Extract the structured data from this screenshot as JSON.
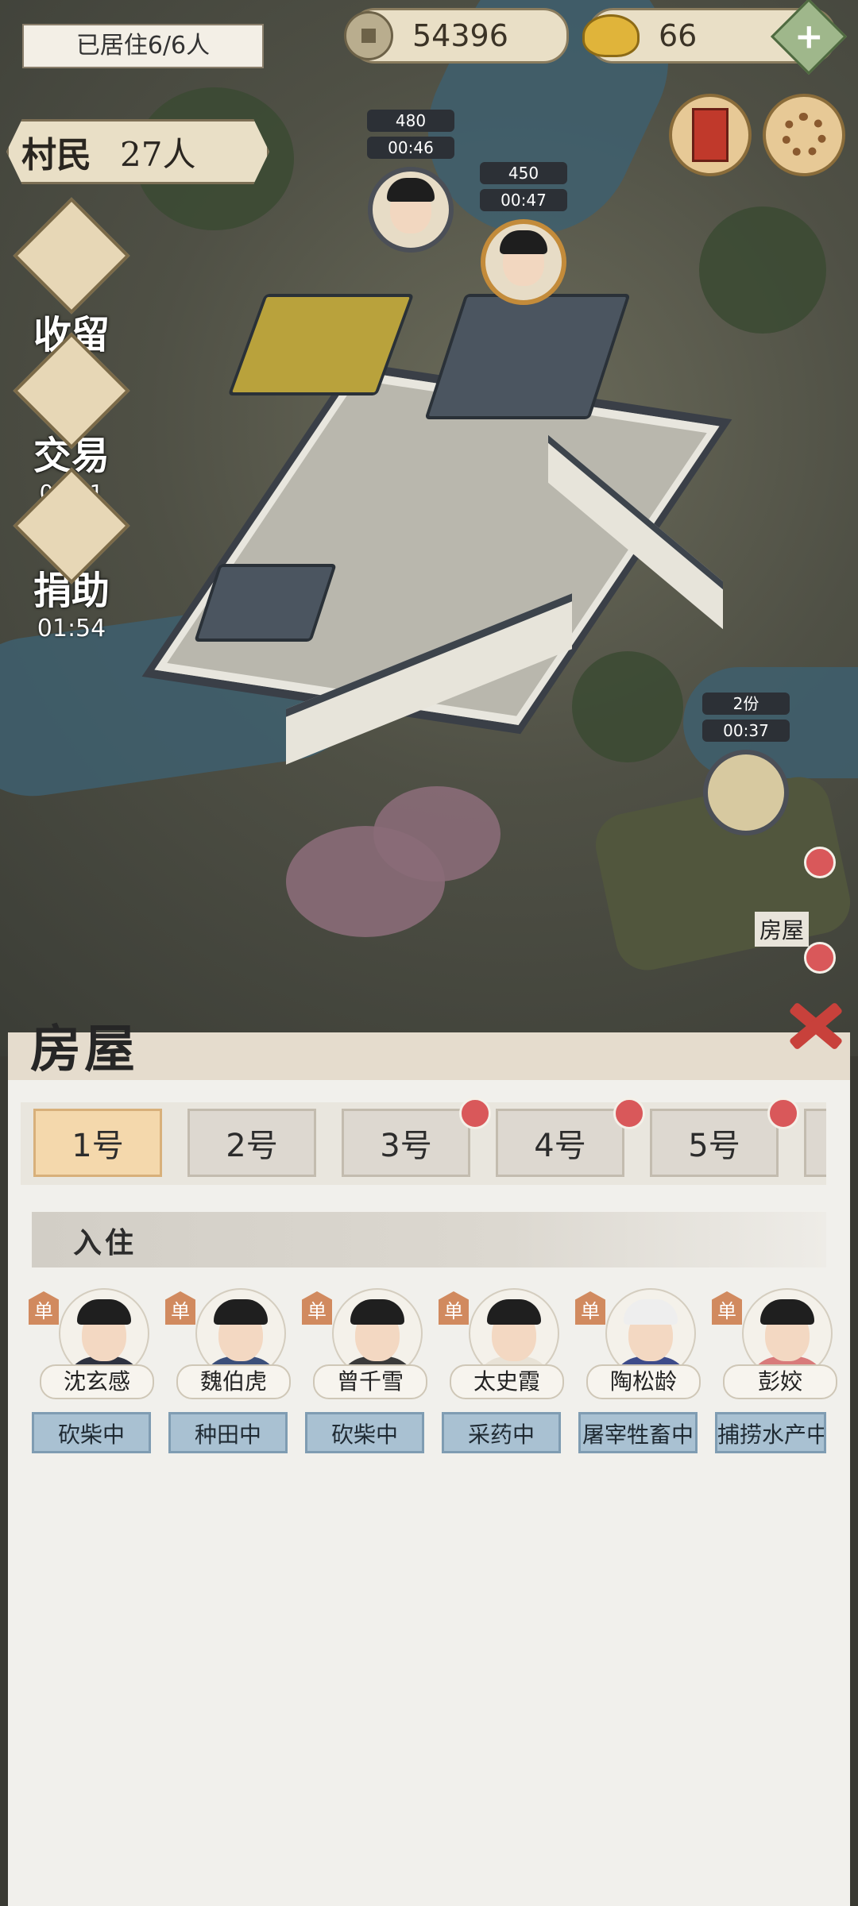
{
  "hud": {
    "occupancy_banner": "已居住6/6人",
    "coins": "54396",
    "ingots": "66",
    "plus_icon": "plus-icon",
    "villagers_label": "村民",
    "villagers_count": "27人"
  },
  "side_buttons": {
    "shelter": {
      "label": "收留"
    },
    "trade": {
      "label": "交易",
      "timer": "00:21"
    },
    "donate": {
      "label": "捐助",
      "timer": "01:54"
    }
  },
  "map_markers": {
    "m1": {
      "amount": "480",
      "timer": "00:46"
    },
    "m2": {
      "amount": "450",
      "timer": "00:47"
    },
    "m3": {
      "amount": "2份",
      "timer": "00:37"
    },
    "house_label": "房屋"
  },
  "panel": {
    "title": "房屋",
    "tabs": [
      {
        "label": "1号",
        "active": true,
        "red_dot": false
      },
      {
        "label": "2号",
        "active": false,
        "red_dot": false
      },
      {
        "label": "3号",
        "active": false,
        "red_dot": true
      },
      {
        "label": "4号",
        "active": false,
        "red_dot": true
      },
      {
        "label": "5号",
        "active": false,
        "red_dot": true
      }
    ],
    "section_title": "入住",
    "residents": [
      {
        "tag": "单",
        "name": "沈玄感",
        "status": "砍柴中"
      },
      {
        "tag": "单",
        "name": "魏伯虎",
        "status": "种田中"
      },
      {
        "tag": "单",
        "name": "曾千雪",
        "status": "砍柴中"
      },
      {
        "tag": "单",
        "name": "太史霞",
        "status": "采药中"
      },
      {
        "tag": "单",
        "name": "陶松龄",
        "status": "屠宰牲畜中"
      },
      {
        "tag": "单",
        "name": "彭姣",
        "status": "捕捞水产中"
      }
    ]
  },
  "colors": {
    "tab_active": "#f4d8ac",
    "status_bg": "#a9c1d2",
    "red_dot": "#d9585a",
    "close_x": "#c8413b"
  }
}
